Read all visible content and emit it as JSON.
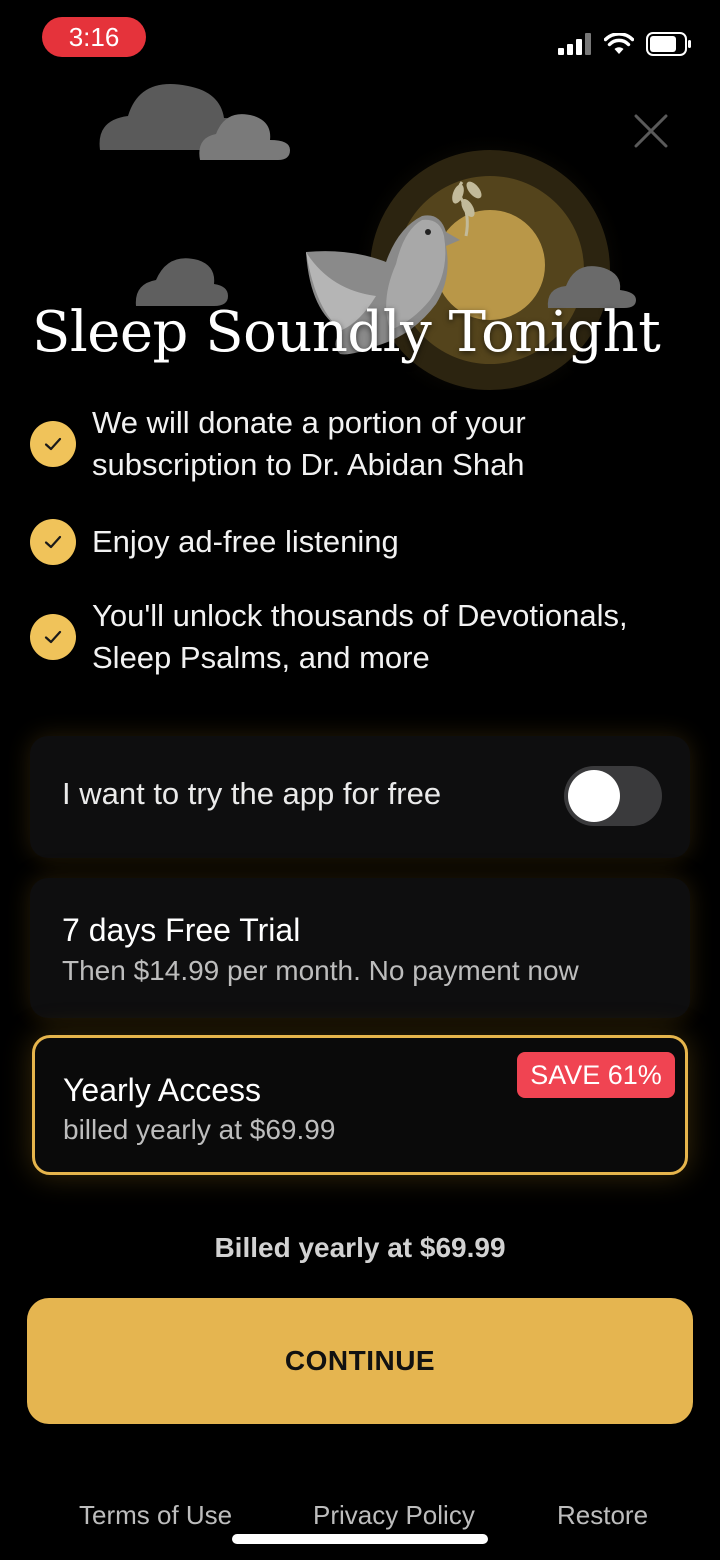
{
  "status_bar": {
    "time": "3:16",
    "time_pill_color": "#e5333b",
    "icons": [
      "cellular-signal-icon",
      "wifi-icon",
      "battery-icon"
    ]
  },
  "close_icon": "close-icon",
  "hero": {
    "illustration": [
      "cloud-icon",
      "dove-with-olive-branch-icon",
      "moon-icon"
    ]
  },
  "headline": "Sleep Soundly Tonight",
  "benefits": [
    {
      "text": "We will donate a portion of your subscription to Dr. Abidan Shah",
      "icon": "checkmark-icon"
    },
    {
      "text": "Enjoy ad-free listening",
      "icon": "checkmark-icon"
    },
    {
      "text": "You'll unlock thousands of Devotionals, Sleep Psalms, and more",
      "icon": "checkmark-icon"
    }
  ],
  "free_trial_toggle": {
    "label": "I want to try the app for free",
    "on": false
  },
  "plans": {
    "trial": {
      "title": "7 days Free Trial",
      "subtitle": "Then $14.99 per month. No payment now"
    },
    "yearly": {
      "title": "Yearly Access",
      "subtitle": "billed yearly at $69.99",
      "badge": "SAVE 61%",
      "selected": true
    }
  },
  "billed_note": "Billed yearly at $69.99",
  "continue_label": "CONTINUE",
  "footer": {
    "terms": "Terms of Use",
    "privacy": "Privacy Policy",
    "restore": "Restore"
  },
  "colors": {
    "accent": "#e5b550",
    "check": "#f0c35a",
    "badge": "#f04452",
    "background": "#000000"
  }
}
